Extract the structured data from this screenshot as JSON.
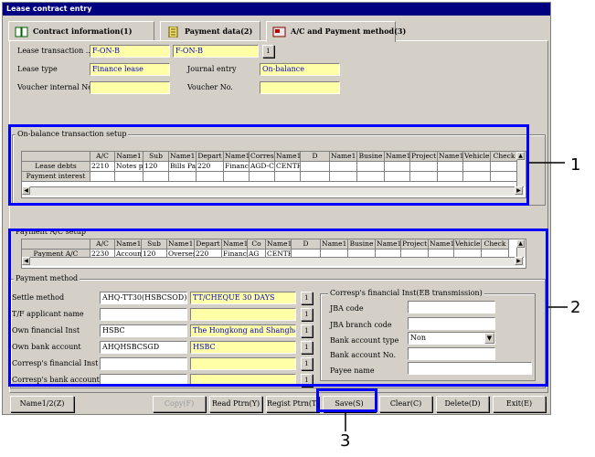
{
  "window": {
    "title": "Lease contract entry"
  },
  "tabs": [
    {
      "label": "Contract information(1)",
      "icon": "book-icon"
    },
    {
      "label": "Payment data(2)",
      "icon": "notepad-icon"
    },
    {
      "label": "A/C and Payment method(3)",
      "icon": "card-icon"
    }
  ],
  "header": {
    "lease_transaction_label": "Lease transaction ...",
    "lease_transaction_code": "F-ON-B",
    "lease_transaction_name": "F-ON-B",
    "lease_transaction_btn": "1",
    "lease_type_label": "Lease type",
    "lease_type_value": "Finance lease",
    "journal_entry_label": "Journal entry",
    "journal_entry_value": "On-balance",
    "voucher_internal_label": "Voucher internal No.",
    "voucher_internal_value": "",
    "voucher_no_label": "Voucher No.",
    "voucher_no_value": ""
  },
  "onbalance": {
    "title": "On-balance transaction setup",
    "columns": [
      "A/C",
      "Name1",
      "Sub",
      "Name1",
      "Depart",
      "Name1",
      "Corres",
      "Name1",
      "D",
      "Name1",
      "Busine",
      "Name1",
      "Project",
      "Name1",
      "Vehicle",
      "Check"
    ],
    "rows": [
      {
        "label": "Lease debts",
        "cells": [
          "2210",
          "Notes p",
          "120",
          "Bills Pa",
          "220",
          "Finance",
          "AGD-C",
          "CENTR",
          "",
          "",
          "",
          "",
          "",
          "",
          "",
          ""
        ]
      },
      {
        "label": "Payment interest",
        "cells": [
          "",
          "",
          "",
          "",
          "",
          "",
          "",
          "",
          "",
          "",
          "",
          "",
          "",
          "",
          "",
          ""
        ]
      }
    ]
  },
  "payment_ac": {
    "title": "Payment A/C setup",
    "columns": [
      "A/C",
      "Name1",
      "Sub",
      "Name1",
      "Depart",
      "Name1",
      "Co",
      "Name1",
      "D",
      "Name1",
      "Busine",
      "Name1",
      "Project",
      "Name1",
      "Vehicle",
      "Check"
    ],
    "rows": [
      {
        "label": "Payment A/C",
        "cells": [
          "2230",
          "Accoun",
          "120",
          "Overses",
          "220",
          "Finance",
          "AG",
          "CENTR",
          "",
          "",
          "",
          "",
          "",
          "",
          "",
          ""
        ]
      }
    ]
  },
  "payment_method": {
    "title": "Payment method",
    "rows": [
      {
        "label": "Settle method",
        "code": "AHQ-TT30(HSBCSOD)",
        "name": "TT/CHEQUE 30 DAYS"
      },
      {
        "label": "T/F applicant name",
        "code": "",
        "name": ""
      },
      {
        "label": "Own financial Inst",
        "code": "HSBC",
        "name": "The Hongkong and Shanghai"
      },
      {
        "label": "Own bank account",
        "code": "AHQHSBCSGD",
        "name": "HSBC"
      },
      {
        "label": "Corresp's financial Inst",
        "code": "",
        "name": ""
      },
      {
        "label": "Corresp's bank account",
        "code": "",
        "name": ""
      }
    ],
    "btn": "1"
  },
  "eb": {
    "title": "Corresp's financial Inst(EB transmission)",
    "jba_code_label": "JBA code",
    "jba_code_value": "",
    "jba_branch_label": "JBA branch code",
    "jba_branch_value": "",
    "account_type_label": "Bank account type",
    "account_type_value": "Non",
    "account_no_label": "Bank account No.",
    "account_no_value": "",
    "payee_label": "Payee name",
    "payee_value": ""
  },
  "buttons": {
    "name1": "Name1/2(Z)",
    "copy": "Copy(F)",
    "read_ptrn": "Read Ptrn(Y)",
    "regist_ptrn": "Regist Ptrn(T)",
    "save": "Save(S)",
    "clear": "Clear(C)",
    "delete": "Delete(D)",
    "exit": "Exit(E)"
  },
  "callouts": {
    "one": "1",
    "two": "2",
    "three": "3"
  },
  "colors": {
    "title_bar": "#000080",
    "field_yellow": "#ffffa8",
    "highlight": "#0000ff",
    "window": "#d4d0c8"
  }
}
